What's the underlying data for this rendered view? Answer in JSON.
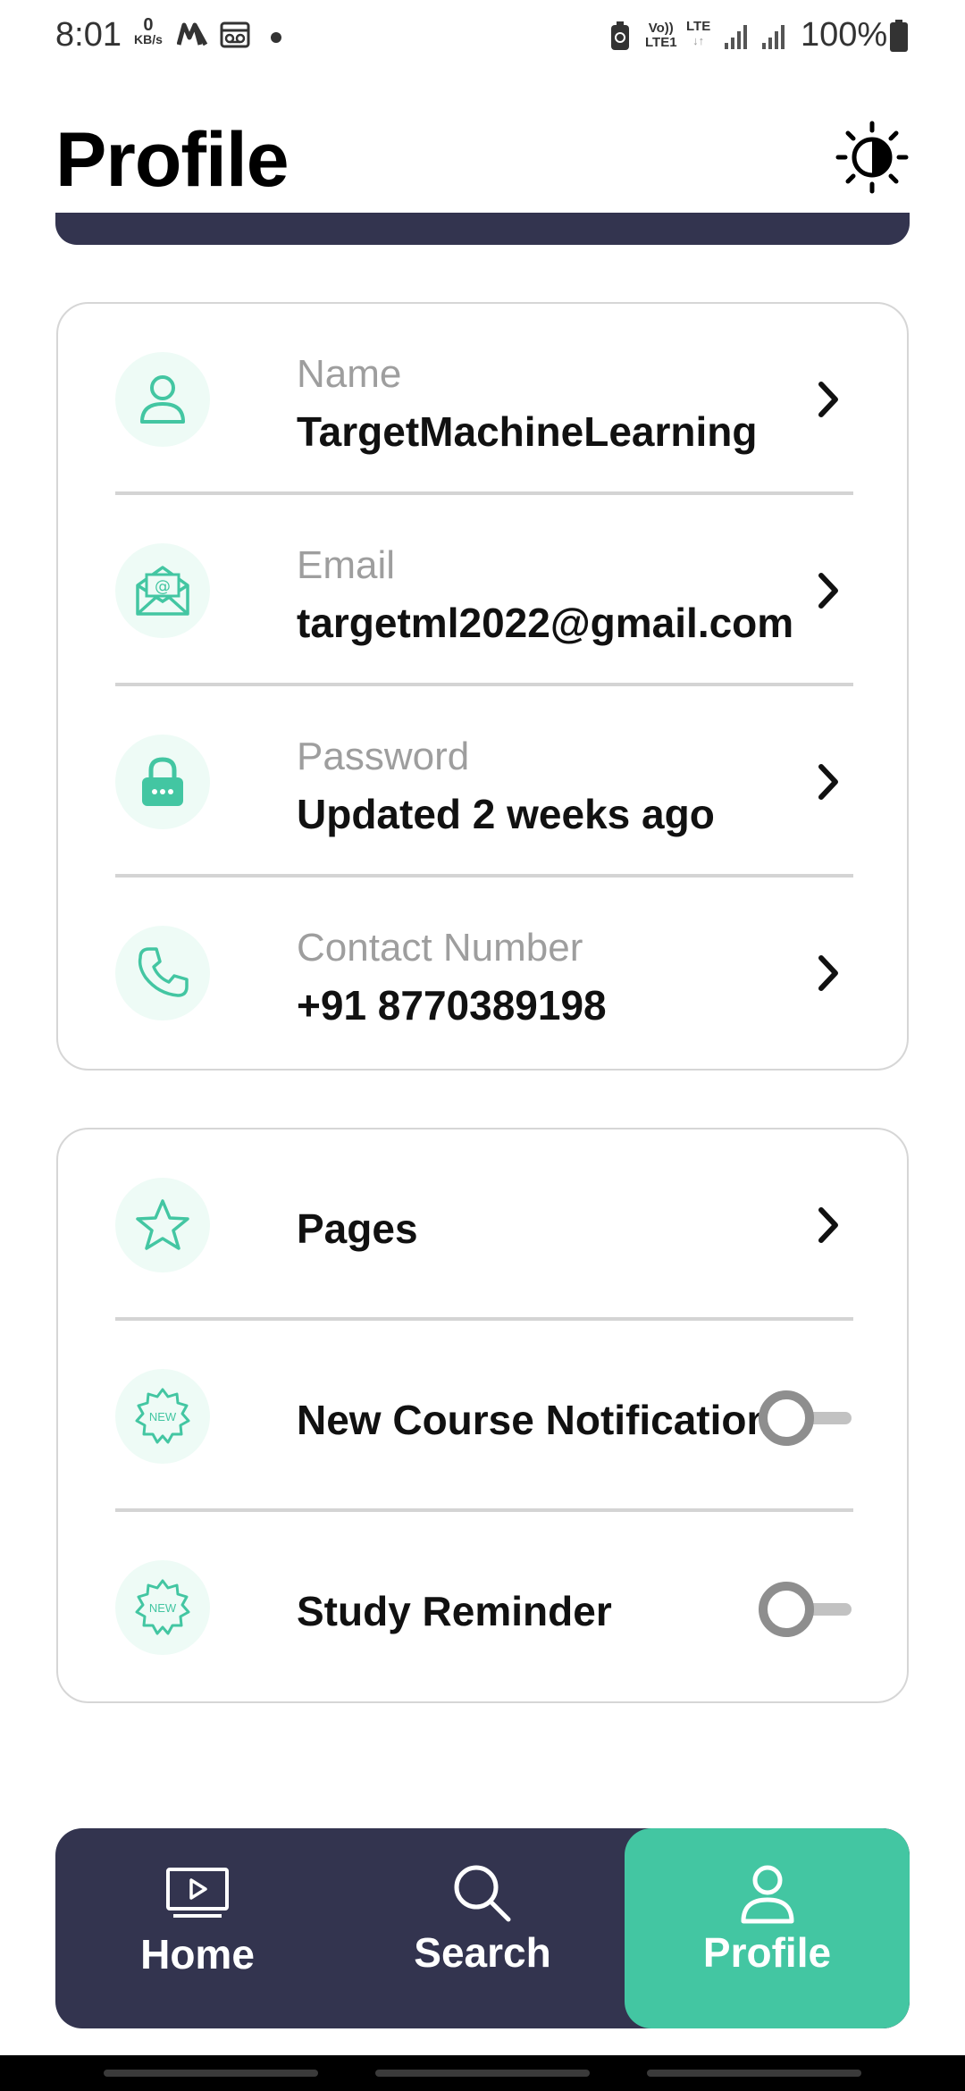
{
  "status_bar": {
    "time": "8:01",
    "net_speed_value": "0",
    "net_speed_unit": "KB/s",
    "volte_top": "Vo))",
    "volte_bottom": "LTE1",
    "lte": "LTE",
    "battery": "100%"
  },
  "header": {
    "title": "Profile",
    "theme_icon": "brightness-contrast-icon"
  },
  "account_card": {
    "items": [
      {
        "icon": "user-icon",
        "label": "Name",
        "value": "TargetMachineLearning"
      },
      {
        "icon": "email-icon",
        "label": "Email",
        "value": "targetml2022@gmail.com"
      },
      {
        "icon": "lock-icon",
        "label": "Password",
        "value": "Updated 2 weeks ago"
      },
      {
        "icon": "phone-icon",
        "label": "Contact Number",
        "value": "+91 8770389198"
      }
    ]
  },
  "settings_card": {
    "items": [
      {
        "icon": "star-icon",
        "label": "Pages",
        "control": "chevron"
      },
      {
        "icon": "new-badge-icon",
        "label": "New Course Notifications",
        "control": "toggle",
        "enabled": false
      },
      {
        "icon": "new-badge-icon",
        "label": "Study Reminder",
        "control": "toggle",
        "enabled": false
      }
    ]
  },
  "badge_text": "NEW",
  "bottom_nav": {
    "items": [
      {
        "icon": "video-play-icon",
        "label": "Home",
        "active": false
      },
      {
        "icon": "search-icon",
        "label": "Search",
        "active": false
      },
      {
        "icon": "user-icon",
        "label": "Profile",
        "active": true
      }
    ]
  },
  "colors": {
    "accent": "#43c6a2",
    "dark": "#33344f",
    "icon_bg": "#eefbf6"
  }
}
